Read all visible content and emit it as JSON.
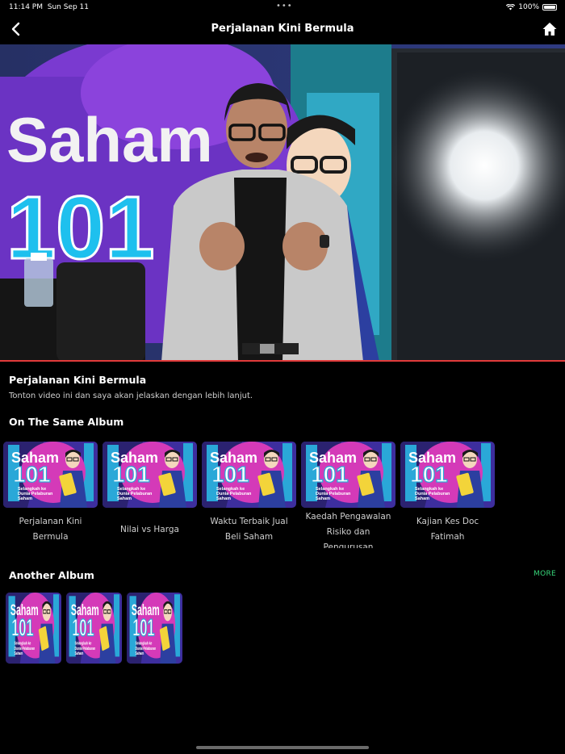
{
  "status_bar": {
    "time": "11:14 PM",
    "date": "Sun Sep 11",
    "battery": "100%"
  },
  "nav": {
    "title": "Perjalanan Kini Bermula"
  },
  "video": {
    "progress_fraction": 0.0
  },
  "episode": {
    "title": "Perjalanan Kini Bermula",
    "description": "Tonton video ini dan saya akan jelaskan dengan lebih lanjut."
  },
  "same_album": {
    "heading": "On The Same Album",
    "thumb_text": {
      "line1": "Saham",
      "line2": "101",
      "line3": "Selangkah ke",
      "line4": "Dunia Pelaburan",
      "line5": "Saham"
    },
    "items": [
      {
        "caption": "Perjalanan Kini Bermula"
      },
      {
        "caption": "Nilai vs Harga"
      },
      {
        "caption": "Waktu Terbaik Jual Beli Saham"
      },
      {
        "caption": "Kaedah Pengawalan Risiko dan Pengurusan"
      },
      {
        "caption": "Kajian Kes Doc Fatimah"
      }
    ]
  },
  "another_album": {
    "heading": "Another Album",
    "more_label": "MORE",
    "count": 3
  },
  "colors": {
    "accent_green": "#37d67a",
    "thumb_bg": "#3d2e9e",
    "thumb_cyan": "#2aa8d8",
    "thumb_magenta": "#d43ab8"
  }
}
